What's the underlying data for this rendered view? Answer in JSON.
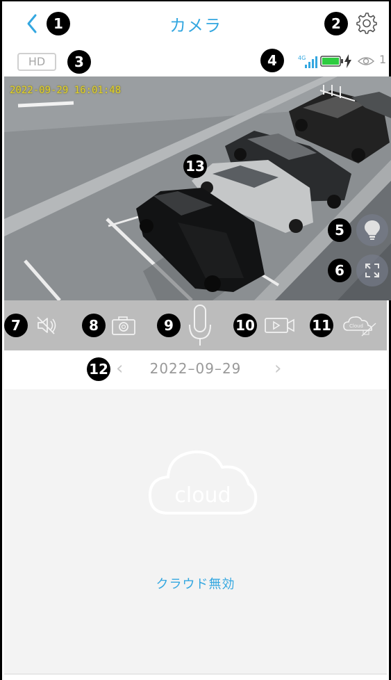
{
  "header": {
    "title": "カメラ",
    "back_glyph": "‹",
    "settings_icon": "gear-icon"
  },
  "status": {
    "quality_label": "HD",
    "network_label": "4G",
    "viewer_count": "1",
    "battery_color": "#2ecc40"
  },
  "video": {
    "timestamp": "2022-09-29 16:01:48",
    "light_icon": "bulb-icon",
    "fullscreen_icon": "fullscreen-icon"
  },
  "toolbar": {
    "tools": [
      "mute-icon",
      "snapshot-icon",
      "microphone-icon",
      "record-icon",
      "cloud-off-icon"
    ],
    "cloud_icon_label": "Cloud"
  },
  "date_nav": {
    "date": "2022–09–29",
    "prev_glyph": "‹",
    "next_glyph": "›"
  },
  "cloud": {
    "icon_label": "cloud",
    "status": "クラウド無効"
  },
  "markers": [
    "❶",
    "❷",
    "❸",
    "❹",
    "❺",
    "❻",
    "❼",
    "❽",
    "❾",
    "❿",
    "⓫",
    "⓬",
    "⓭"
  ],
  "colors": {
    "accent": "#34a7e0",
    "toolbar_bg": "#bcbcbc",
    "panel_bg": "#f3f3f3"
  }
}
